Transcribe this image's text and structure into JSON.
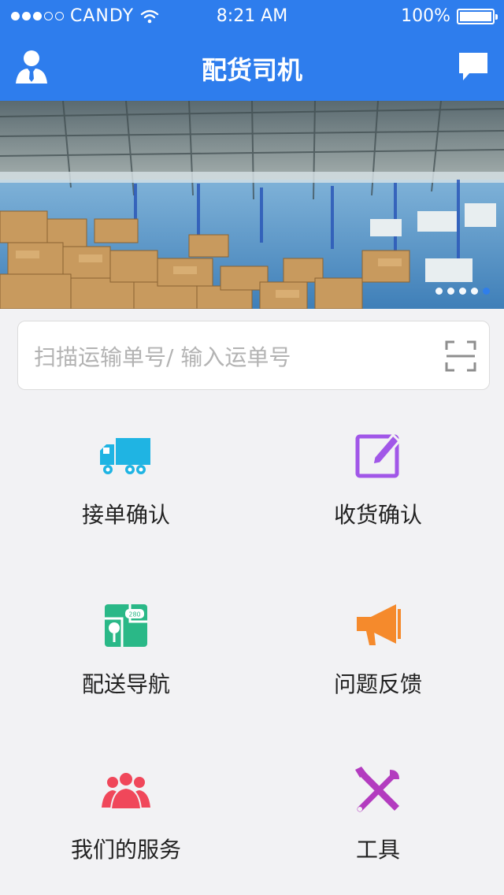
{
  "status": {
    "carrier": "CANDY",
    "time": "8:21 AM",
    "battery": "100%",
    "signal_dots_filled": 3
  },
  "nav": {
    "title": "配货司机",
    "left_icon": "user-icon",
    "right_icon": "message-icon"
  },
  "banner": {
    "pages": 5,
    "active_page": 5
  },
  "search": {
    "placeholder": "扫描运输单号/ 输入运单号",
    "value": "",
    "icon": "scan-icon"
  },
  "menu": [
    {
      "label": "接单确认",
      "icon": "truck-icon",
      "color": "#1fb4e3"
    },
    {
      "label": "收货确认",
      "icon": "edit-icon",
      "color": "#a157e8"
    },
    {
      "label": "配送导航",
      "icon": "map-icon",
      "color": "#2ab887"
    },
    {
      "label": "问题反馈",
      "icon": "megaphone-icon",
      "color": "#f58a2c"
    },
    {
      "label": "我们的服务",
      "icon": "group-icon",
      "color": "#f0475a"
    },
    {
      "label": "工具",
      "icon": "tools-icon",
      "color": "#b33cbf"
    }
  ],
  "colors": {
    "accent": "#2e7ded",
    "background": "#f2f2f4"
  }
}
